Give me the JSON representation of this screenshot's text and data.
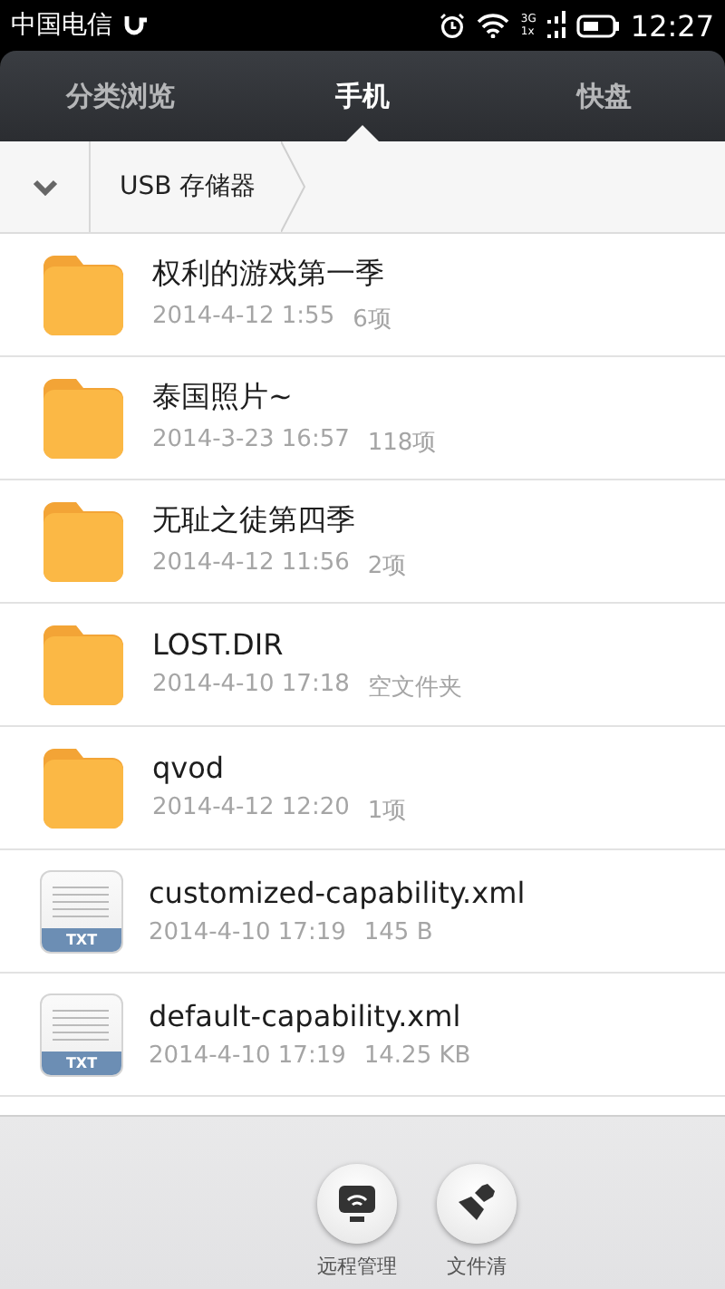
{
  "status_bar": {
    "carrier": "中国电信",
    "network_top": "3G",
    "network_bottom": "1x",
    "time": "12:27"
  },
  "tabs": [
    {
      "label": "分类浏览",
      "selected": false
    },
    {
      "label": "手机",
      "selected": true
    },
    {
      "label": "快盘",
      "selected": false
    }
  ],
  "breadcrumb": {
    "items": [
      "USB 存储器"
    ]
  },
  "files": [
    {
      "kind": "folder",
      "name": "权利的游戏第一季",
      "date": "2014-4-12 1:55",
      "info": "6项"
    },
    {
      "kind": "folder",
      "name": "泰国照片~",
      "date": "2014-3-23 16:57",
      "info": "118项"
    },
    {
      "kind": "folder",
      "name": "无耻之徒第四季",
      "date": "2014-4-12 11:56",
      "info": "2项"
    },
    {
      "kind": "folder",
      "name": "LOST.DIR",
      "date": "2014-4-10 17:18",
      "info": "空文件夹"
    },
    {
      "kind": "folder",
      "name": "qvod",
      "date": "2014-4-12 12:20",
      "info": "1项"
    },
    {
      "kind": "txt",
      "badge": "TXT",
      "name": "customized-capability.xml",
      "date": "2014-4-10 17:19",
      "info": "145 B"
    },
    {
      "kind": "txt",
      "badge": "TXT",
      "name": "default-capability.xml",
      "date": "2014-4-10 17:19",
      "info": "14.25 KB"
    }
  ],
  "toolbar": [
    {
      "kind": "remote",
      "label": "远程管理"
    },
    {
      "kind": "clean",
      "label": "文件清"
    }
  ]
}
